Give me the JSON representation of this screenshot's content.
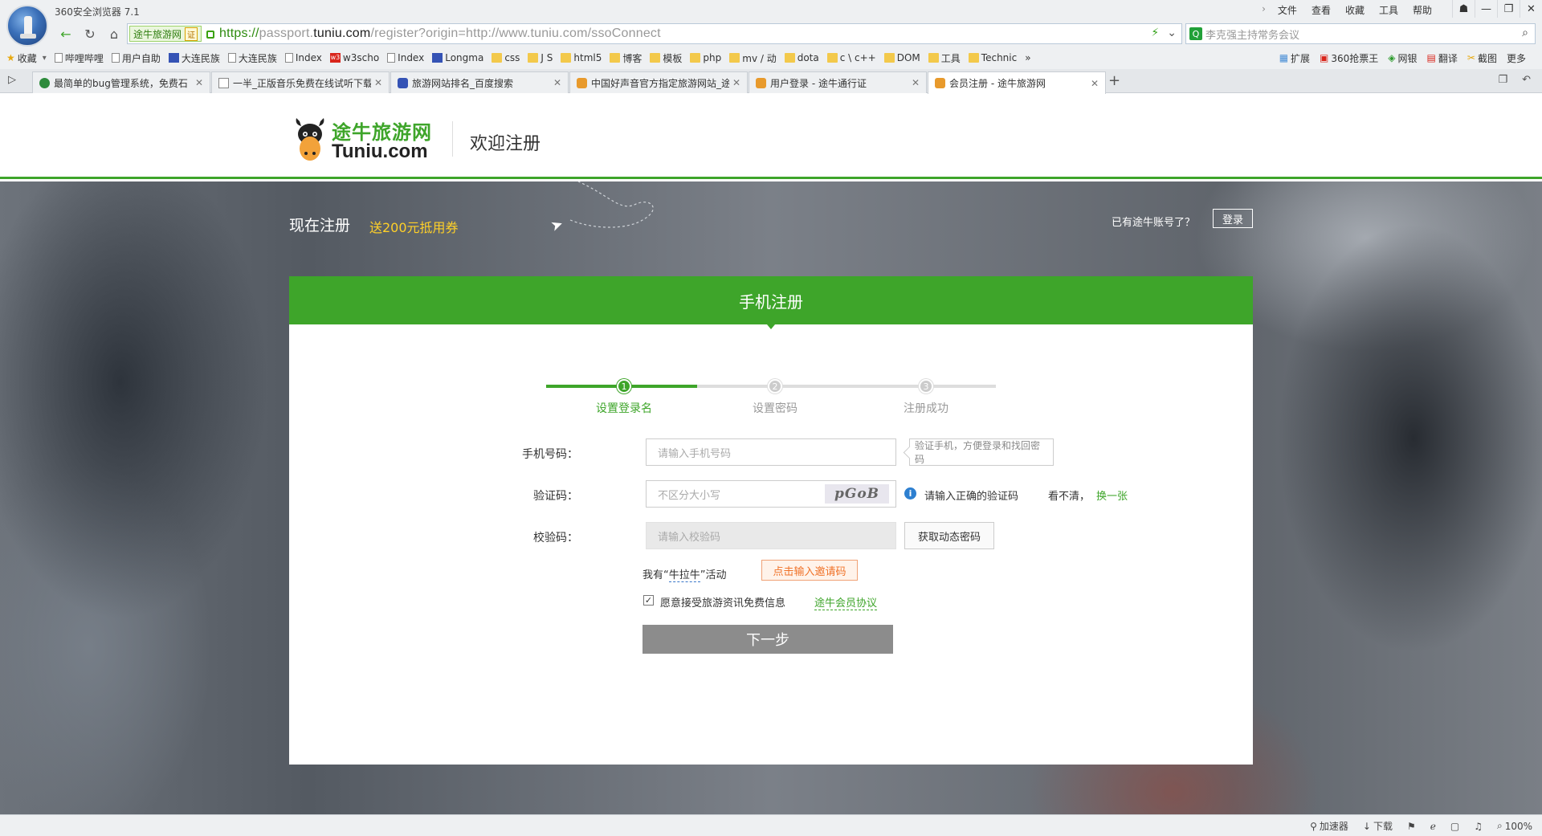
{
  "browser": {
    "title": "360安全浏览器 7.1",
    "menu": [
      "文件",
      "查看",
      "收藏",
      "工具",
      "帮助"
    ],
    "menu_chevron": "›",
    "window_controls": {
      "skin": "☗",
      "minimize": "—",
      "maximize": "❐",
      "close": "✕"
    },
    "url": {
      "cert_site": "途牛旅游网",
      "cert_badge": "证",
      "scheme": "https://",
      "sub": "passport.",
      "domain": "tuniu.com",
      "path": "/register?origin=http://www.tuniu.com/ssoConnect"
    },
    "search_placeholder": "李克强主持常务会议",
    "bookmarks": [
      {
        "label": "收藏",
        "icon": "star-icon"
      },
      {
        "label": "哔哩哔哩",
        "icon": "page-icon"
      },
      {
        "label": "用户自助",
        "icon": "page-icon"
      },
      {
        "label": "大连民族",
        "icon": "paw-icon"
      },
      {
        "label": "大连民族",
        "icon": "page-icon"
      },
      {
        "label": "Index",
        "icon": "page-icon"
      },
      {
        "label": "w3scho",
        "icon": "w3-icon"
      },
      {
        "label": "Index",
        "icon": "page-icon"
      },
      {
        "label": "Longma",
        "icon": "blue-icon"
      },
      {
        "label": "css",
        "icon": "folder-icon"
      },
      {
        "label": "J S",
        "icon": "folder-icon"
      },
      {
        "label": "html5",
        "icon": "folder-icon"
      },
      {
        "label": "博客",
        "icon": "folder-icon"
      },
      {
        "label": "模板",
        "icon": "folder-icon"
      },
      {
        "label": "php",
        "icon": "folder-icon"
      },
      {
        "label": "mv / 动",
        "icon": "folder-icon"
      },
      {
        "label": "dota",
        "icon": "folder-icon"
      },
      {
        "label": "c \\ c++",
        "icon": "folder-icon"
      },
      {
        "label": "DOM",
        "icon": "folder-icon"
      },
      {
        "label": "工具",
        "icon": "folder-icon"
      },
      {
        "label": "Technic",
        "icon": "folder-icon"
      }
    ],
    "bookmark_more": "»",
    "toolbar_right": [
      "扩展",
      "360抢票王",
      "网银",
      "翻译",
      "截图",
      "更多"
    ],
    "tabs": [
      {
        "title": "最简单的bug管理系统，免费石",
        "active": false
      },
      {
        "title": "一半_正版音乐免费在线试听下载",
        "active": false
      },
      {
        "title": "旅游网站排名_百度搜索",
        "active": false
      },
      {
        "title": "中国好声音官方指定旅游网站_途",
        "active": false
      },
      {
        "title": "用户登录 - 途牛通行证",
        "active": false
      },
      {
        "title": "会员注册 - 途牛旅游网",
        "active": true
      }
    ],
    "status": [
      "加速器",
      "下载",
      "100%"
    ]
  },
  "header": {
    "logo_cn": "途牛旅游网",
    "logo_en": "Tuniu.com",
    "welcome": "欢迎注册"
  },
  "hero": {
    "register_now": "现在注册",
    "promo": "送200元抵用券",
    "have_account": "已有途牛账号了？",
    "login": "登录"
  },
  "form": {
    "title": "手机注册",
    "steps": [
      {
        "num": "1",
        "label": "设置登录名",
        "done": true
      },
      {
        "num": "2",
        "label": "设置密码",
        "done": false
      },
      {
        "num": "3",
        "label": "注册成功",
        "done": false
      }
    ],
    "phone_label": "手机号码：",
    "phone_placeholder": "请输入手机号码",
    "phone_tip": "验证手机，方便登录和找回密码",
    "captcha_label": "验证码：",
    "captcha_placeholder": "不区分大小写",
    "captcha_image_text": "pGoB",
    "captcha_error": "请输入正确的验证码",
    "cant_see": "看不清，",
    "change_one": "换一张",
    "code_label": "校验码：",
    "code_placeholder": "请输入校验码",
    "get_code": "获取动态密码",
    "have_prefix": "我有“",
    "niulaniu": "牛拉牛",
    "have_suffix": "”活动",
    "invite_button": "点击输入邀请码",
    "agree_checked": true,
    "agree_text": "愿意接受旅游资讯免费信息",
    "member_agreement": "途牛会员协议",
    "next": "下一步"
  }
}
